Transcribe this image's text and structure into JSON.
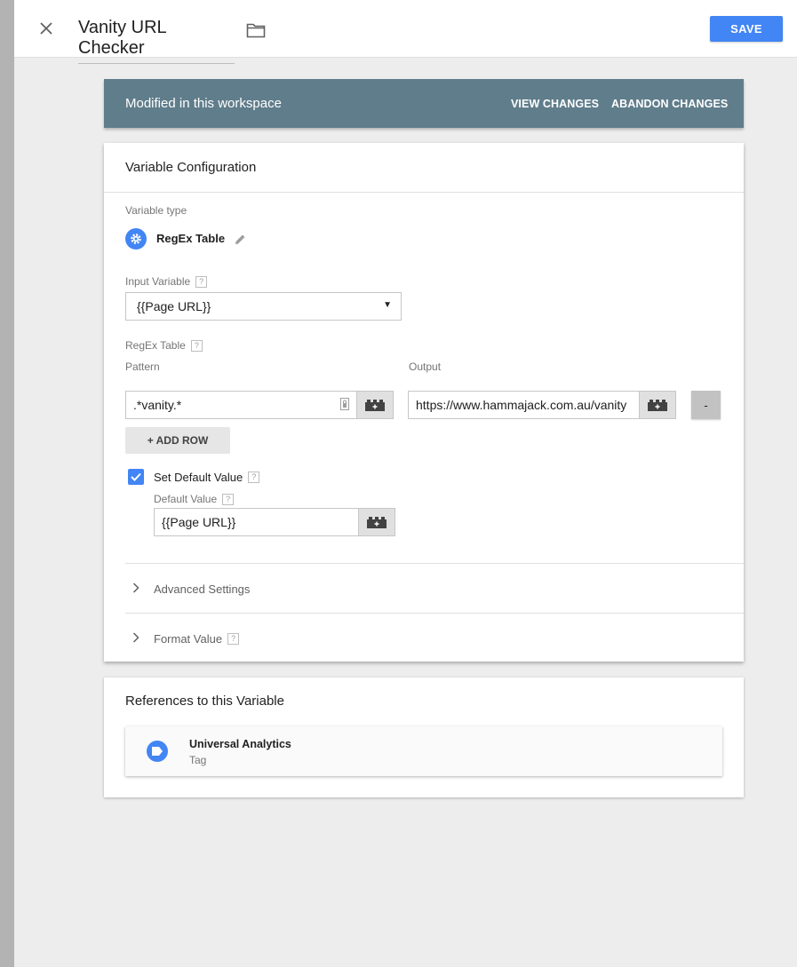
{
  "header": {
    "title": "Vanity URL Checker",
    "save_label": "SAVE"
  },
  "banner": {
    "text": "Modified in this workspace",
    "view_changes": "VIEW CHANGES",
    "abandon_changes": "ABANDON CHANGES"
  },
  "config": {
    "title": "Variable Configuration",
    "variable_type_label": "Variable type",
    "variable_type": "RegEx Table",
    "input_variable_label": "Input Variable",
    "input_variable_value": "{{Page URL}}",
    "regex_table_label": "RegEx Table",
    "pattern_label": "Pattern",
    "output_label": "Output",
    "rows": [
      {
        "pattern": ".*vanity.*",
        "output": "https://www.hammajack.com.au/vanity"
      }
    ],
    "remove_label": "-",
    "add_row_label": "+ ADD ROW",
    "set_default_label": "Set Default Value",
    "set_default_checked": true,
    "default_value_label": "Default Value",
    "default_value": "{{Page URL}}",
    "advanced_settings_label": "Advanced Settings",
    "format_value_label": "Format Value",
    "help_glyph": "?"
  },
  "references": {
    "title": "References to this Variable",
    "items": [
      {
        "name": "Universal Analytics",
        "type": "Tag"
      }
    ]
  },
  "colors": {
    "accent": "#4285f4",
    "banner": "#607d8b",
    "background": "#ededed"
  },
  "icons": [
    "close-icon",
    "folder-icon",
    "gear-icon",
    "pencil-icon",
    "dropdown-arrow-icon",
    "lock-icon",
    "variable-brick-icon",
    "checkmark-icon",
    "chevron-right-icon",
    "tag-icon"
  ]
}
